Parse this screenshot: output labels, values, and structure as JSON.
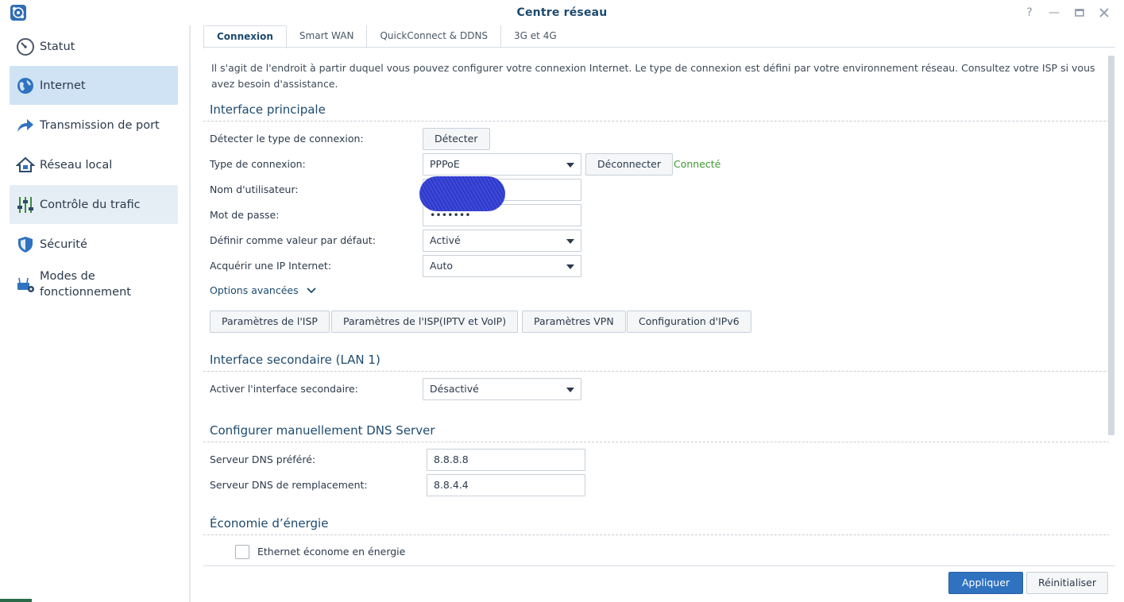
{
  "window": {
    "title": "Centre réseau"
  },
  "sidebar": {
    "items": [
      {
        "label": "Statut",
        "icon": "gauge-icon"
      },
      {
        "label": "Internet",
        "icon": "globe-icon"
      },
      {
        "label": "Transmission de port",
        "icon": "share-arrow-icon"
      },
      {
        "label": "Réseau local",
        "icon": "home-network-icon"
      },
      {
        "label": "Contrôle du trafic",
        "icon": "sliders-icon"
      },
      {
        "label": "Sécurité",
        "icon": "shield-icon"
      },
      {
        "label": "Modes de",
        "label2": "fonctionnement",
        "icon": "router-gear-icon"
      }
    ]
  },
  "tabs": [
    {
      "label": "Connexion"
    },
    {
      "label": "Smart WAN"
    },
    {
      "label": "QuickConnect & DDNS"
    },
    {
      "label": "3G et 4G"
    }
  ],
  "intro": {
    "text": "Il s'agit de l'endroit à partir duquel vous pouvez configurer votre connexion Internet. Le type de connexion est défini par votre environnement réseau. Consultez votre ISP si vous avez besoin d'assistance."
  },
  "primary": {
    "title": "Interface principale",
    "detect_label": "Détecter le type de connexion:",
    "detect_button": "Détecter",
    "type_label": "Type de connexion:",
    "type_value": "PPPoE",
    "disconnect_button": "Déconnecter",
    "status": "Connecté",
    "username_label": "Nom d'utilisateur:",
    "username_value": "",
    "password_label": "Mot de passe:",
    "password_value": "•••••••",
    "default_label": "Définir comme valeur par défaut:",
    "default_value": "Activé",
    "ip_label": "Acquérir une IP Internet:",
    "ip_value": "Auto",
    "advanced_label": "Options avancées",
    "buttons": [
      "Paramètres de l'ISP",
      "Paramètres de l'ISP(IPTV et VoIP)",
      "Paramètres VPN",
      "Configuration d'IPv6"
    ]
  },
  "secondary": {
    "title": "Interface secondaire (LAN 1)",
    "enable_label": "Activer l'interface secondaire:",
    "enable_value": "Désactivé"
  },
  "dns": {
    "title": "Configurer manuellement DNS Server",
    "preferred_label": "Serveur DNS préféré:",
    "preferred_value": "8.8.8.8",
    "alternate_label": "Serveur DNS de remplacement:",
    "alternate_value": "8.8.4.4"
  },
  "energy": {
    "title": "Économie d’énergie",
    "checkbox_label": "Ethernet économe en énergie",
    "checked": false
  },
  "footer": {
    "apply_button": "Appliquer",
    "reset_button": "Réinitialiser"
  },
  "colors": {
    "accent": "#2f72c0",
    "title": "#1d4a6e",
    "active_nav": "#cfe3f5",
    "status_ok": "#3c9b31"
  }
}
